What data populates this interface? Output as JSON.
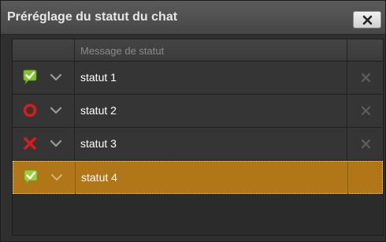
{
  "window": {
    "title": "Préréglage du statut du chat",
    "close_label": "close"
  },
  "table": {
    "column_header": "Message de statut",
    "rows": [
      {
        "label": "statut 1",
        "icon": "green-check-icon",
        "selected": false,
        "deletable": true
      },
      {
        "label": "statut 2",
        "icon": "red-circle-icon",
        "selected": false,
        "deletable": true
      },
      {
        "label": "statut 3",
        "icon": "red-x-icon",
        "selected": false,
        "deletable": true
      },
      {
        "label": "statut 4",
        "icon": "green-check-icon",
        "selected": true,
        "deletable": false
      }
    ]
  },
  "colors": {
    "window_bg": "#2f2f2f",
    "row_bg": "#353535",
    "selected_row_bg": "#b07618",
    "check_green": "#7ec52e",
    "busy_red": "#d81b1b"
  }
}
